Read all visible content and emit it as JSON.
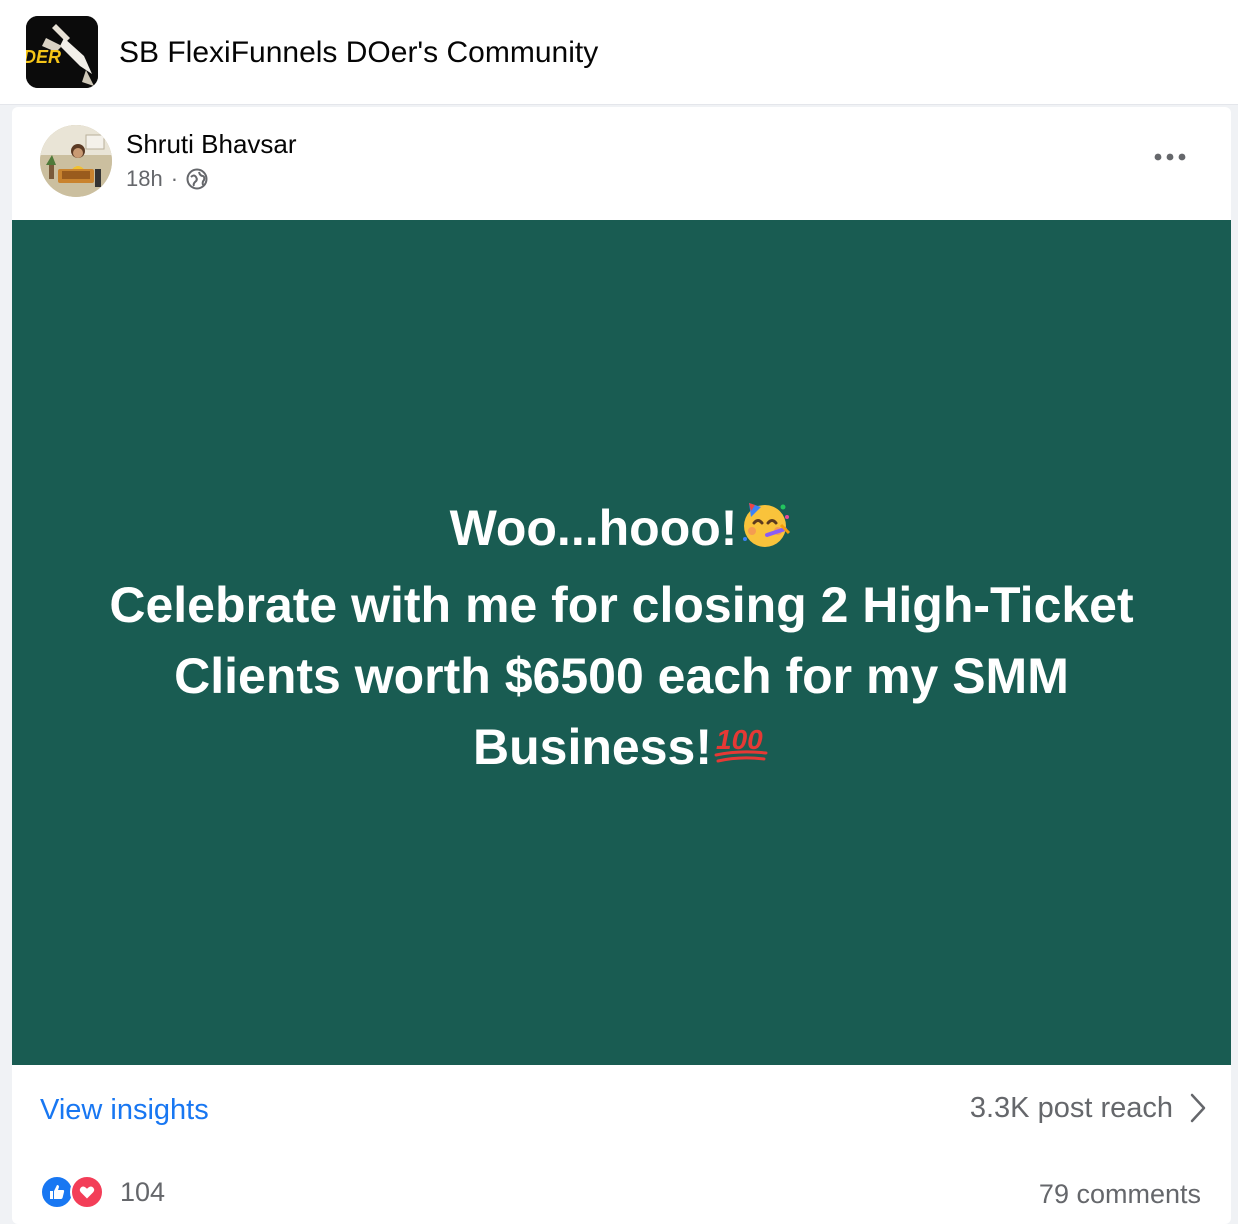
{
  "group": {
    "logo_text": "DER",
    "name": "SB FlexiFunnels DOer's Community"
  },
  "post": {
    "author": "Shruti Bhavsar",
    "time": "18h",
    "separator": "·",
    "privacy_icon": "globe-icon",
    "more_icon": "more-options-icon",
    "background_color": "#195c52",
    "text_lines": [
      "Woo...hooo!",
      "Celebrate with me for closing 2 High-Ticket",
      "Clients worth $6500 each for my SMM",
      "Business!"
    ],
    "emojis": [
      "partying-face-emoji",
      "hundred-points-emoji"
    ]
  },
  "footer": {
    "insights_label": "View insights",
    "reach_label": "3.3K post reach",
    "reach_chevron_icon": "chevron-right-icon",
    "reaction_types": [
      "like-icon",
      "love-icon"
    ],
    "reaction_count": "104",
    "comments_label": "79 comments"
  },
  "colors": {
    "link_blue": "#1877f2",
    "secondary_text": "#65676b",
    "post_background": "#195c52",
    "love_red": "#f33e58"
  }
}
